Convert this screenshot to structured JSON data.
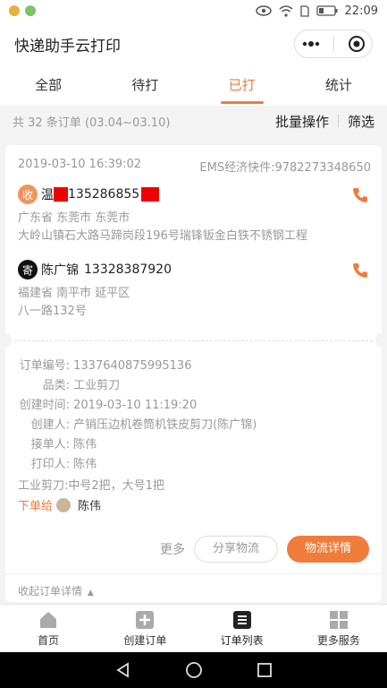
{
  "statusbar": {
    "time": "22:09"
  },
  "header": {
    "title": "快递助手云打印"
  },
  "tabs": [
    {
      "label": "全部"
    },
    {
      "label": "待打"
    },
    {
      "label": "已打"
    },
    {
      "label": "统计"
    }
  ],
  "toolbar": {
    "count": "共 32 条订单 (03.04~03.10)",
    "batch": "批量操作",
    "filter": "筛选"
  },
  "order": {
    "datetime": "2019-03-10 16:39:02",
    "express": "EMS经济快件:9782273348650",
    "receiver": {
      "badge": "收",
      "name": "温",
      "phone": "135286855",
      "region": "广东省 东莞市 东莞市",
      "address": "大岭山镇石大路马蹄岗段196号瑞锋钣金白铁不锈钢工程"
    },
    "sender": {
      "badge": "寄",
      "name": "陈广锦",
      "phone": "13328387920",
      "region": "福建省 南平市 延平区",
      "address": "八一路132号"
    },
    "info": [
      {
        "key": "订单编号:",
        "value": "1337640875995136"
      },
      {
        "key": "品类:",
        "value": "工业剪刀"
      },
      {
        "key": "创建时间:",
        "value": "2019-03-10 11:19:20"
      },
      {
        "key": "创建人:",
        "value": "产销压边机卷筒机铁皮剪刀(陈广锦)"
      },
      {
        "key": "接单人:",
        "value": "陈伟"
      },
      {
        "key": "打印人:",
        "value": "陈伟"
      }
    ],
    "note": "工业剪刀:中号2把，大号1把",
    "assign_label": "下单给",
    "assign_name": "陈伟",
    "more": "更多",
    "share": "分享物流",
    "detail": "物流详情",
    "collapse": "收起订单详情"
  },
  "tabbar": [
    {
      "label": "首页",
      "icon": "home-icon"
    },
    {
      "label": "创建订单",
      "icon": "plus-icon"
    },
    {
      "label": "订单列表",
      "icon": "list-icon"
    },
    {
      "label": "更多服务",
      "icon": "grid-icon"
    }
  ],
  "colors": {
    "accent": "#f07c3b",
    "receiver_badge": "#f0955a",
    "sender_badge": "#111111"
  }
}
